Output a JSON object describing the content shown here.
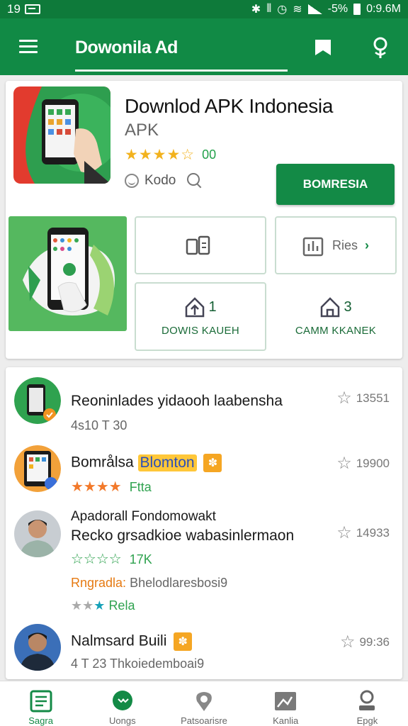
{
  "status_bar": {
    "time_left": "19",
    "battery": "-5%",
    "time_right": "0:9.6M"
  },
  "app_bar": {
    "title": "Dowonila Ad"
  },
  "featured": {
    "name": "Downlod APK Indonesia",
    "subtitle": "APK",
    "stars": "★★★★☆",
    "rating_count": "00",
    "developer": "Kodo",
    "install_label": "BOMRESIA",
    "tiles": [
      {
        "text": ""
      },
      {
        "text": "Ries"
      },
      {
        "value": "1",
        "label": "DOWIS KAUEH"
      },
      {
        "value": "3",
        "label": "CAMM KKANEK"
      }
    ]
  },
  "list": [
    {
      "title": "Reoninlades yidaooh laabensha",
      "sub": "4s10 T 30",
      "stat": "13551"
    },
    {
      "title": "Bområlsa",
      "badge": "Blomton",
      "stars": "★★★★",
      "tag": "Ftta",
      "stat": "19900"
    },
    {
      "title_top": "Apadorall Fondomowakt",
      "title": "Recko grsadkioe wabasinlermaon",
      "stars": "☆☆☆☆",
      "count": "17K",
      "tag_label": "Rngradla:",
      "tag_value": "Bhelodlaresbosi9",
      "sub": "Rela",
      "stat": "14933"
    },
    {
      "title": "Nalmsard Buili",
      "sub": "4 T 23  Thkoiedemboai9",
      "stat": "99:36"
    }
  ],
  "bottom_nav": [
    {
      "label": "Sagra"
    },
    {
      "label": "Uongs"
    },
    {
      "label": "Patsoarisre"
    },
    {
      "label": "Kanlia"
    },
    {
      "label": "Epgk"
    }
  ],
  "colors": {
    "primary": "#118a45",
    "status": "#0e7a3a",
    "star": "#f2b21e"
  }
}
